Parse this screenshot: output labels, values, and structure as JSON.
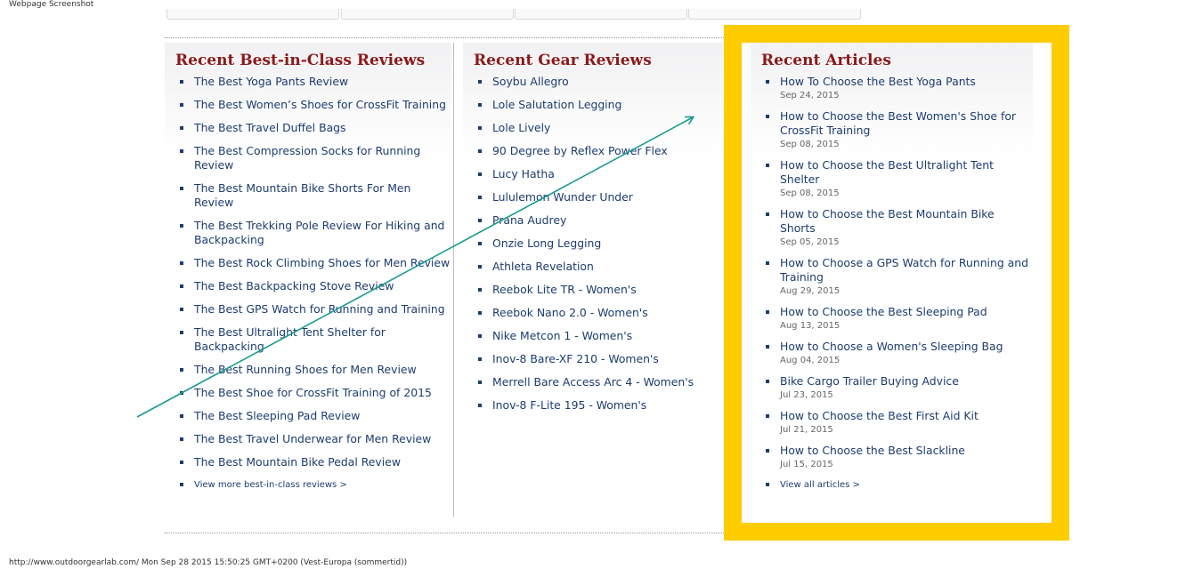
{
  "page": {
    "caption": "Webpage Screenshot",
    "footer": "http://www.outdoorgearlab.com/ Mon Sep 28 2015 15:50:25 GMT+0200 (Vest-Europa (sommertid))"
  },
  "colors": {
    "heading": "#8b1a1a",
    "link": "#1d3c6e",
    "highlight": "#ffcc00",
    "arrow": "#1a9a8f"
  },
  "best_in_class": {
    "title": "Recent Best-in-Class Reviews",
    "items": [
      "The Best Yoga Pants Review",
      "The Best Women’s Shoes for CrossFit Training",
      "The Best Travel Duffel Bags",
      "The Best Compression Socks for Running Review",
      "The Best Mountain Bike Shorts For Men Review",
      "The Best Trekking Pole Review For Hiking and Backpacking",
      "The Best Rock Climbing Shoes for Men Review",
      "The Best Backpacking Stove Review",
      "The Best GPS Watch for Running and Training",
      "The Best Ultralight Tent Shelter for Backpacking",
      "The Best Running Shoes for Men Review",
      "The Best Shoe for CrossFit Training of 2015",
      "The Best Sleeping Pad Review",
      "The Best Travel Underwear for Men Review",
      "The Best Mountain Bike Pedal Review"
    ],
    "more": "View more best-in-class reviews >"
  },
  "gear_reviews": {
    "title": "Recent Gear Reviews",
    "items": [
      "Soybu Allegro",
      "Lole Salutation Legging",
      "Lole Lively",
      "90 Degree by Reflex Power Flex",
      "Lucy Hatha",
      "Lululemon Wunder Under",
      "Prana Audrey",
      "Onzie Long Legging",
      "Athleta Revelation",
      "Reebok Lite TR - Women's",
      "Reebok Nano 2.0 - Women's",
      "Nike Metcon 1 - Women's",
      "Inov-8 Bare-XF 210 - Women's",
      "Merrell Bare Access Arc 4 - Women's",
      "Inov-8 F-Lite 195 - Women's"
    ]
  },
  "articles": {
    "title": "Recent Articles",
    "items": [
      {
        "title": "How To Choose the Best Yoga Pants",
        "date": "Sep 24, 2015"
      },
      {
        "title": "How to Choose the Best Women's Shoe for CrossFit Training",
        "date": "Sep 08, 2015"
      },
      {
        "title": "How to Choose the Best Ultralight Tent Shelter",
        "date": "Sep 08, 2015"
      },
      {
        "title": "How to Choose the Best Mountain Bike Shorts",
        "date": "Sep 05, 2015"
      },
      {
        "title": "How to Choose a GPS Watch for Running and Training",
        "date": "Aug 29, 2015"
      },
      {
        "title": "How to Choose the Best Sleeping Pad",
        "date": "Aug 13, 2015"
      },
      {
        "title": "How to Choose a Women's Sleeping Bag",
        "date": "Aug 04, 2015"
      },
      {
        "title": "Bike Cargo Trailer Buying Advice",
        "date": "Jul 23, 2015"
      },
      {
        "title": "How to Choose the Best First Aid Kit",
        "date": "Jul 21, 2015"
      },
      {
        "title": "How to Choose the Best Slackline",
        "date": "Jul 15, 2015"
      }
    ],
    "more": "View all articles >"
  }
}
